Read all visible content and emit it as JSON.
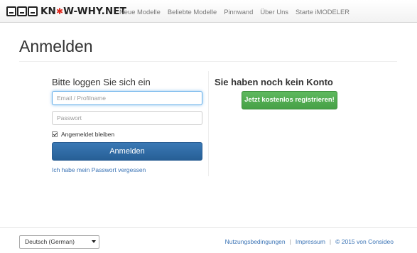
{
  "brand": {
    "logo_text_1": "KN",
    "logo_star": "✱",
    "logo_text_2": "W-WHY.NET"
  },
  "nav": {
    "items": [
      "Neue Modelle",
      "Beliebte Modelle",
      "Pinnwand",
      "Über Uns",
      "Starte iMODELER"
    ]
  },
  "page": {
    "title": "Anmelden"
  },
  "login": {
    "heading": "Bitte loggen Sie sich ein",
    "email_placeholder": "Email / Profilname",
    "password_placeholder": "Passwort",
    "remember_label": "Angemeldet bleiben",
    "remember_checked": true,
    "submit_label": "Anmelden",
    "forgot_label": "Ich habe mein Passwort vergessen"
  },
  "register": {
    "heading": "Sie haben noch kein Konto",
    "button_label": "Jetzt kostenlos registrieren!"
  },
  "footer": {
    "language": "Deutsch (German)",
    "links": [
      "Nutzungsbedingungen",
      "Impressum",
      "© 2015 von Consideo"
    ]
  },
  "colors": {
    "primary": "#2e6da4",
    "success": "#4cae4c",
    "link": "#3a73b5"
  }
}
